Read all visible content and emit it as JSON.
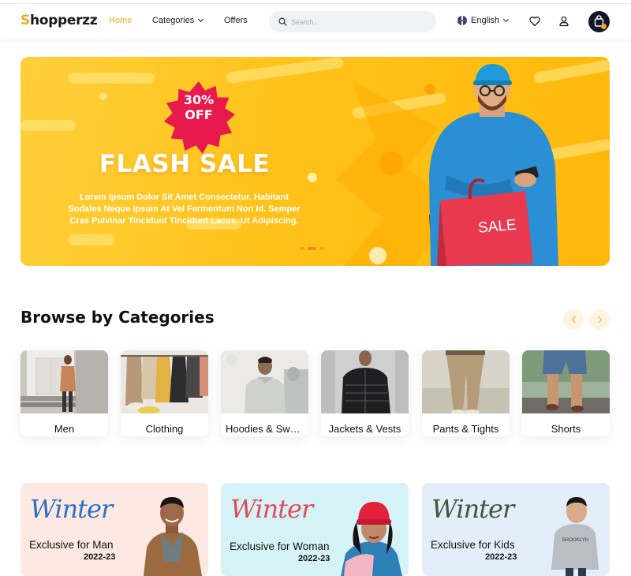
{
  "header": {
    "logo": {
      "s": "S",
      "rest": "hopperzz"
    },
    "nav": [
      {
        "label": "Home",
        "active": true
      },
      {
        "label": "Categories",
        "active": false
      },
      {
        "label": "Offers",
        "active": false
      }
    ],
    "search": {
      "placeholder": "Search..",
      "value": ""
    },
    "language": "English",
    "icons": [
      "search-icon",
      "flag-icon",
      "heart-icon",
      "user-icon",
      "cart-icon"
    ],
    "accent": "#f5a623"
  },
  "hero": {
    "badge_line1": "30%",
    "badge_line2": "OFF",
    "title": "FLASH SALE",
    "subtitle": "Lorem Ipsum Dolor Sit Amet Consectetur. Habitant Sodales Neque Ipsum At Vel Fermentum Non Id. Semper Cras Pulvinar Tincidunt Tincidunt Lacus. Ut Adipiscing.",
    "bag_text": "SALE",
    "slides": 3,
    "active_slide": 2
  },
  "categories": {
    "title": "Browse by Categories",
    "items": [
      {
        "label": "Men"
      },
      {
        "label": "Clothing"
      },
      {
        "label": "Hoodies & Sweatshirts"
      },
      {
        "label": "Jackets & Vests"
      },
      {
        "label": "Pants & Tights"
      },
      {
        "label": "Shorts"
      }
    ]
  },
  "promos": [
    {
      "script": "Winter",
      "label": "Exclusive for Man",
      "year": "2022-23",
      "bg": "#fde9e1",
      "script_color": "#2d6fc7"
    },
    {
      "script": "Winter",
      "label": "Exclusive for Woman",
      "year": "2022-23",
      "bg": "#d5f3f7",
      "script_color": "#e04b5a"
    },
    {
      "script": "Winter",
      "label": "Exclusive for Kids",
      "year": "2022-23",
      "bg": "#e4eefb",
      "script_color": "#3c5a3a"
    }
  ]
}
